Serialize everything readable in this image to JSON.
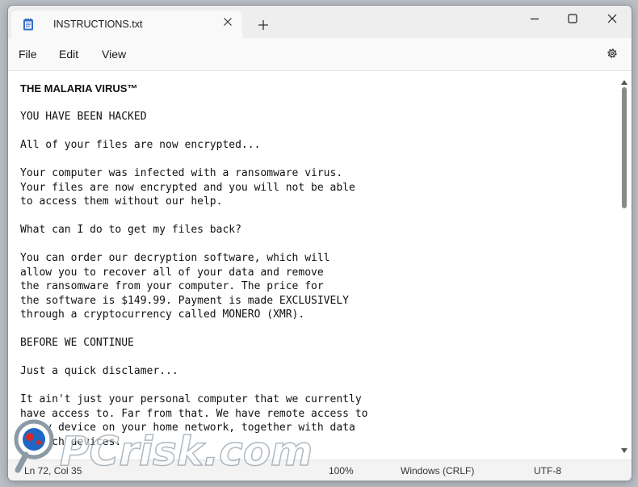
{
  "window": {
    "tab_title": "INSTRUCTIONS.txt",
    "tab_icon": "notepad-icon",
    "controls": [
      "minimize-icon",
      "maximize-icon",
      "close-icon"
    ]
  },
  "menu": {
    "file": "File",
    "edit": "Edit",
    "view": "View",
    "settings_icon": "gear-icon"
  },
  "document": {
    "title": "THE MALARIA VIRUS™",
    "body": "YOU HAVE BEEN HACKED\n\nAll of your files are now encrypted...\n\nYour computer was infected with a ransomware virus.\nYour files are now encrypted and you will not be able\nto access them without our help.\n\nWhat can I do to get my files back?\n\nYou can order our decryption software, which will\nallow you to recover all of your data and remove\nthe ransomware from your computer. The price for\nthe software is $149.99. Payment is made EXCLUSIVELY\nthrough a cryptocurrency called MONERO (XMR).\n\nBEFORE WE CONTINUE\n\nJust a quick disclamer...\n\nIt ain't just your personal computer that we currently\nhave access to. Far from that. We have remote access to\nevery device on your home network, together with data\nof such devices."
  },
  "status": {
    "position": "Ln 72, Col 35",
    "zoom": "100%",
    "line_ending": "Windows (CRLF)",
    "encoding": "UTF-8"
  },
  "watermark": {
    "text": "PCrisk.com"
  }
}
